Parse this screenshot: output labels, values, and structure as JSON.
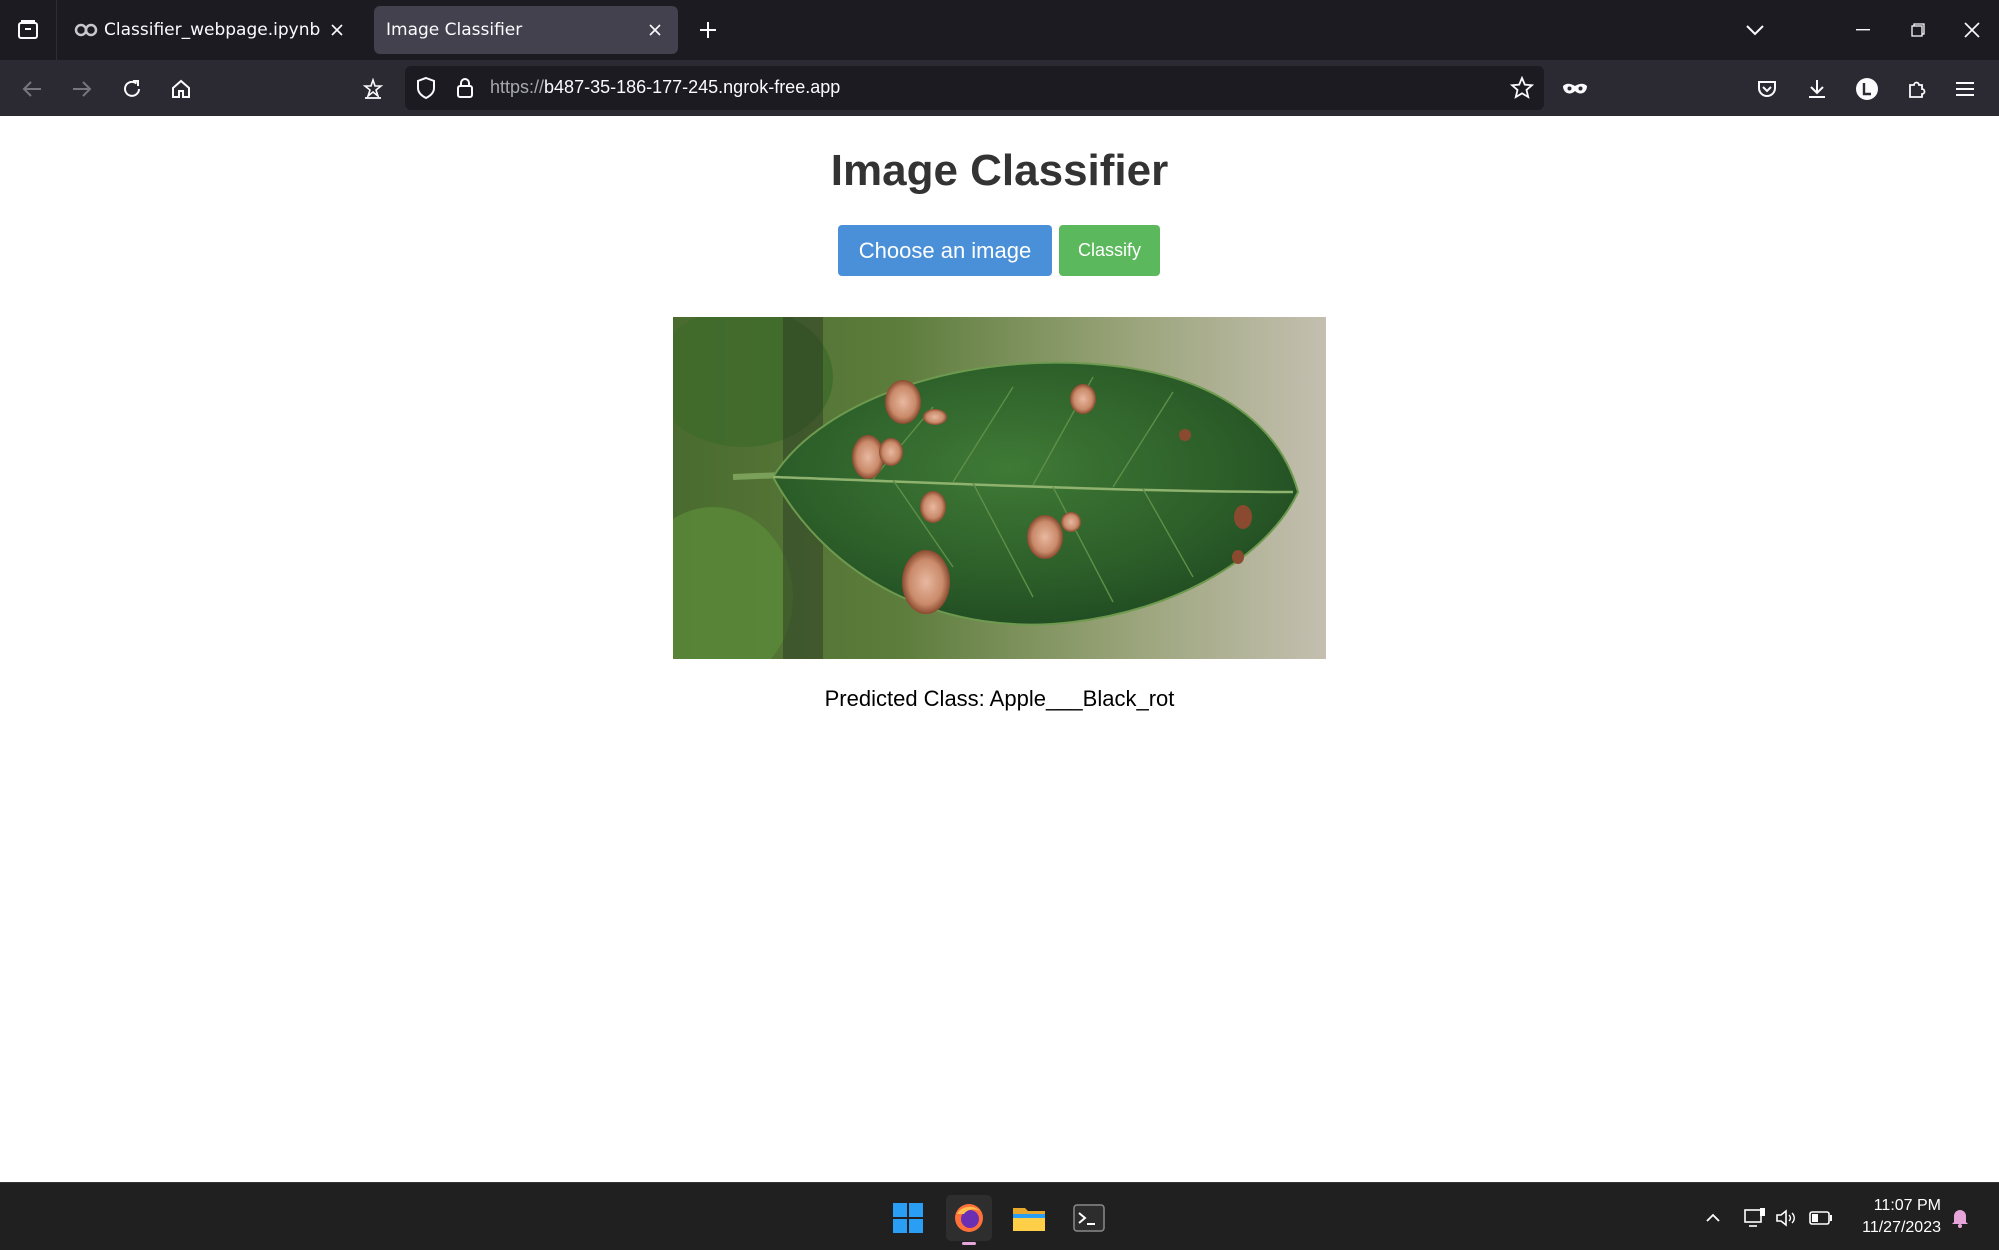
{
  "browser": {
    "tabs": [
      {
        "label": "Classifier_webpage.ipynb - Colab",
        "icon": "colab-icon"
      },
      {
        "label": "Image Classifier",
        "icon": "none"
      }
    ],
    "url_scheme": "https://",
    "url_host": "b487-35-186-177-245.ngrok-free.app"
  },
  "page": {
    "title": "Image Classifier",
    "choose_label": "Choose an image",
    "classify_label": "Classify",
    "image_alt": "apple leaf with brown disease spots",
    "result_text": "Predicted Class: Apple___Black_rot"
  },
  "colors": {
    "choose_button": "#4a90d9",
    "classify_button": "#5cb85c"
  },
  "taskbar": {
    "time": "11:07 PM",
    "date": "11/27/2023"
  }
}
